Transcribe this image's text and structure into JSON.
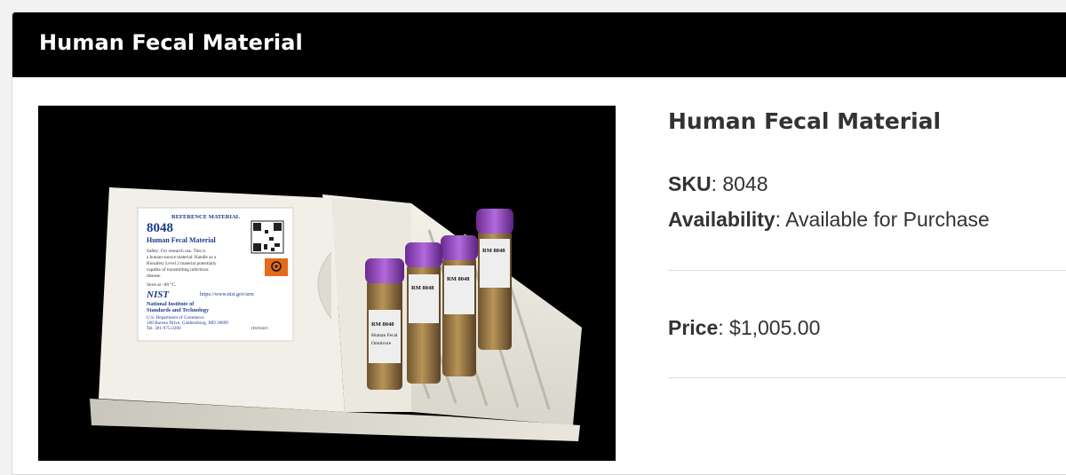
{
  "header": {
    "title": "Human Fecal Material"
  },
  "product": {
    "title": "Human Fecal Material",
    "sku_label": "SKU",
    "sku_value": "8048",
    "availability_label": "Availability",
    "availability_value": "Available for Purchase",
    "price_label": "Price",
    "price_value": "$1,005.00"
  },
  "photo": {
    "box_label": {
      "heading": "REFERENCE MATERIAL",
      "number": "8048",
      "name": "Human Fecal Material",
      "safety_1": "Safety:  For research use.  This is",
      "safety_2": "a human-source material.  Handle as a",
      "safety_3": "Biosafety Level 2 material potentially",
      "safety_4": "capable of transmitting infectious",
      "safety_5": "disease.",
      "storage": "Store at –80 °C.",
      "logo": "NIST",
      "url": "https://www.nist.gov/srm",
      "org_1": "National Institute of",
      "org_2": "Standards and Technology",
      "dept": "U.S. Department of Commerce",
      "address": "100 Bureau Drive, Gaithersburg, MD 20899",
      "tel": "Tel. 301-975-2200",
      "code": "ID230425"
    },
    "vial_label": "RM 8048",
    "vial_text_1": "Human Fecal",
    "vial_text_2": "Omnivore"
  },
  "colors": {
    "header_bg": "#000000",
    "header_text": "#ffffff",
    "text": "#333333",
    "nist_blue": "#1a3a8a",
    "vial_cap": "#8e3fb8"
  }
}
